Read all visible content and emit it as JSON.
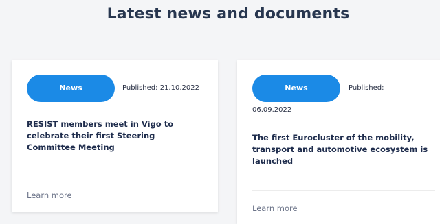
{
  "section": {
    "title": "Latest news and documents"
  },
  "cards": [
    {
      "badge": "News",
      "published_label": "Published:",
      "published_date": "21.10.2022",
      "published_full": "Published: 21.10.2022",
      "headline": "RESIST members meet in Vigo to celebrate their first Steering Committee Meeting",
      "link": "Learn more"
    },
    {
      "badge": "News",
      "published_label": "Published:",
      "published_date": "06.09.2022",
      "headline": "The first Eurocluster of the mobility, transport and automotive ecosystem is launched",
      "link": "Learn more"
    }
  ],
  "colors": {
    "badge_bg": "#1b8ae6",
    "title": "#27364f",
    "link": "#6b7388"
  }
}
